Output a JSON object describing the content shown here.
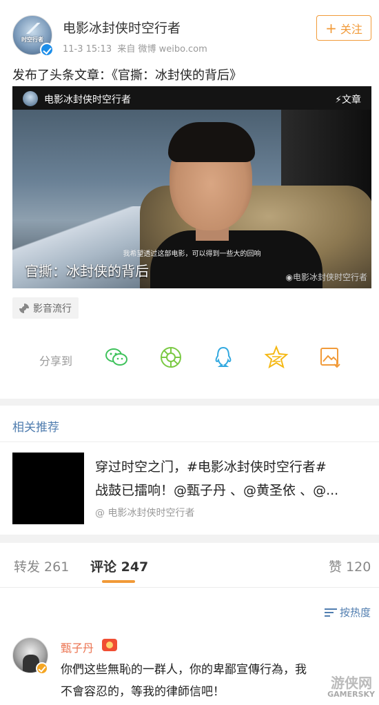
{
  "post": {
    "author": "电影冰封侠时空行者",
    "avatar_text": "时空行者",
    "time": "11-3 15:13",
    "source": "来自 微博 weibo.com",
    "follow_label": "关注",
    "text": "发布了头条文章：《官撕：冰封侠的背后》"
  },
  "article": {
    "source_name": "电影冰封侠时空行者",
    "tag": "文章",
    "subtitle": "我希望透过这部电影，可以得到一些大的回响",
    "title": "官撕：冰封侠的背后",
    "watermark": "电影冰封侠时空行者"
  },
  "source_tag": "影音流行",
  "share": {
    "label": "分享到",
    "icons": [
      "wechat-icon",
      "moments-icon",
      "qq-icon",
      "qzone-icon",
      "save-image-icon"
    ]
  },
  "related": {
    "header": "相关推荐",
    "line1": "穿过时空之门，#电影冰封侠时空行者#",
    "line2": "战鼓已擂响！@甄子丹 、@黄圣依 、@...",
    "source": "@ 电影冰封侠时空行者"
  },
  "tabs": {
    "repost": "转发 261",
    "comments": "评论 247",
    "likes": "赞 120"
  },
  "sort_label": "按热度",
  "comment": {
    "name": "甄子丹",
    "line1": "你們这些無恥的一群人，你的卑鄙宣傳行為，我",
    "line2": "不會容忍的，等我的律師信吧！"
  },
  "site_watermark": {
    "logo": "游侠网",
    "text": "GAMERSKY"
  },
  "colors": {
    "accent": "#f19a38",
    "link": "#507daf",
    "username": "#eb7350",
    "wechat": "#3ec25b",
    "moments": "#7ac943",
    "qq": "#33a9e0",
    "qzone": "#f5b814"
  }
}
